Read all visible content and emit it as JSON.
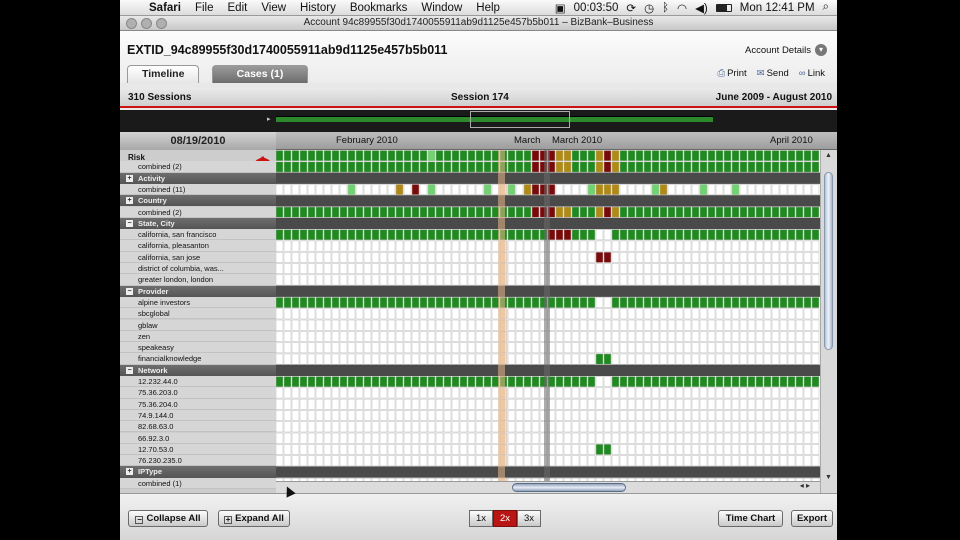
{
  "menubar": {
    "app": "Safari",
    "items": [
      "File",
      "Edit",
      "View",
      "History",
      "Bookmarks",
      "Window",
      "Help"
    ],
    "recording_time": "00:03:50",
    "clock": "Mon 12:41 PM"
  },
  "window": {
    "title": "Account 94c89955f30d1740055911ab9d1125e457b5b011 – BizBank–Business"
  },
  "account": {
    "title": "EXTID_94c89955f30d1740055911ab9d1125e457b5b011",
    "details_label": "Account Details"
  },
  "tabs": [
    {
      "label": "Timeline",
      "active": true
    },
    {
      "label": "Cases (1)",
      "active": false
    }
  ],
  "actions": {
    "print": "Print",
    "send": "Send",
    "link": "Link"
  },
  "session": {
    "count": "310 Sessions",
    "current": "Session 174",
    "range": "June 2009 - August 2010"
  },
  "timeline": {
    "date": "08/19/2010",
    "months": [
      "February 2010",
      "March",
      "March 2010",
      "April 2010"
    ]
  },
  "rows": [
    {
      "type": "risk",
      "label": "Risk"
    },
    {
      "type": "item",
      "label": "combined (2)"
    },
    {
      "type": "section",
      "label": "Activity"
    },
    {
      "type": "item",
      "label": "combined (11)"
    },
    {
      "type": "section",
      "label": "Country"
    },
    {
      "type": "item",
      "label": "combined (2)"
    },
    {
      "type": "section",
      "label": "State, City"
    },
    {
      "type": "item",
      "label": "california, san francisco"
    },
    {
      "type": "item",
      "label": "california, pleasanton"
    },
    {
      "type": "item",
      "label": "california, san jose"
    },
    {
      "type": "item",
      "label": "district of columbia, was..."
    },
    {
      "type": "item",
      "label": "greater london, london"
    },
    {
      "type": "section",
      "label": "Provider"
    },
    {
      "type": "item",
      "label": "alpine investors"
    },
    {
      "type": "item",
      "label": "sbcglobal"
    },
    {
      "type": "item",
      "label": "gblaw"
    },
    {
      "type": "item",
      "label": "zen"
    },
    {
      "type": "item",
      "label": "speakeasy"
    },
    {
      "type": "item",
      "label": "financialknowledge"
    },
    {
      "type": "section",
      "label": "Network"
    },
    {
      "type": "item",
      "label": "12.232.44.0"
    },
    {
      "type": "item",
      "label": "75.36.203.0"
    },
    {
      "type": "item",
      "label": "75.36.204.0"
    },
    {
      "type": "item",
      "label": "74.9.144.0"
    },
    {
      "type": "item",
      "label": "82.68.63.0"
    },
    {
      "type": "item",
      "label": "66.92.3.0"
    },
    {
      "type": "item",
      "label": "12.70.53.0"
    },
    {
      "type": "item",
      "label": "76.230.235.0"
    },
    {
      "type": "section",
      "label": "IPType"
    },
    {
      "type": "item",
      "label": "combined (1)"
    }
  ],
  "footer": {
    "collapse": "Collapse All",
    "expand": "Expand All",
    "zoom": [
      "1x",
      "2x",
      "3x"
    ],
    "zoom_active": "2x",
    "time_chart": "Time Chart",
    "export": "Export"
  },
  "colors": {
    "green": "#1f8a1f",
    "light_green": "#6fd36f",
    "dark_red": "#7a0a0a",
    "amber": "#b08a12",
    "accent_red": "#cc1111"
  }
}
